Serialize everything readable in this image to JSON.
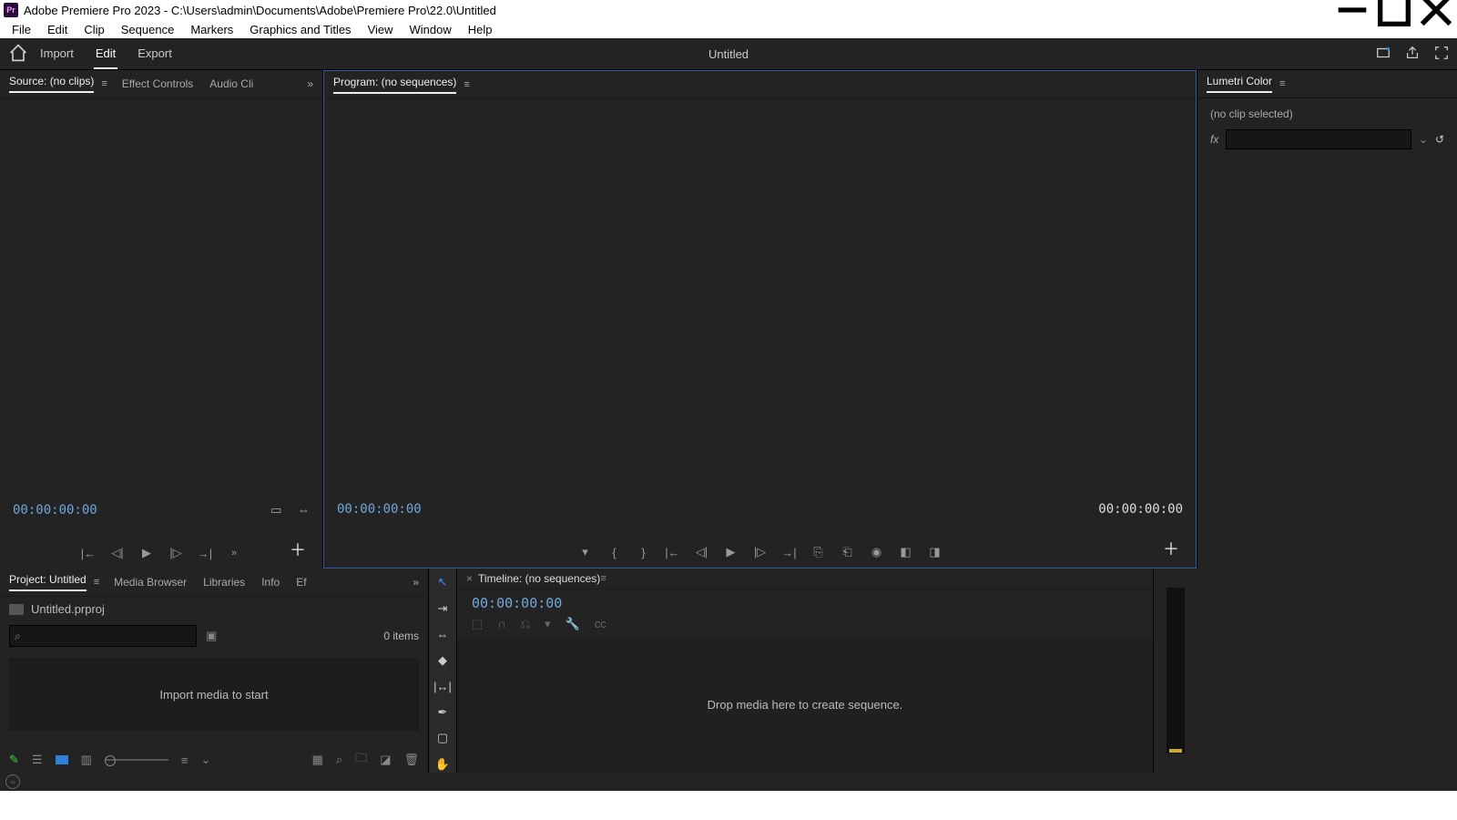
{
  "titlebar": {
    "app_short": "Pr",
    "title": "Adobe Premiere Pro 2023 - C:\\Users\\admin\\Documents\\Adobe\\Premiere Pro\\22.0\\Untitled"
  },
  "menubar": [
    "File",
    "Edit",
    "Clip",
    "Sequence",
    "Markers",
    "Graphics and Titles",
    "View",
    "Window",
    "Help"
  ],
  "workspace": {
    "tabs": [
      "Import",
      "Edit",
      "Export"
    ],
    "active": 1,
    "title": "Untitled"
  },
  "source": {
    "tabs": [
      "Source: (no clips)",
      "Effect Controls",
      "Audio Cli"
    ],
    "active": 0,
    "timecode": "00:00:00:00"
  },
  "program": {
    "title": "Program: (no sequences)",
    "timecode_left": "00:00:00:00",
    "timecode_right": "00:00:00:00"
  },
  "project": {
    "tabs": [
      "Project: Untitled",
      "Media Browser",
      "Libraries",
      "Info",
      "Ef"
    ],
    "active": 0,
    "filename": "Untitled.prproj",
    "items": "0 items",
    "drop_hint": "Import media to start"
  },
  "timeline": {
    "title": "Timeline: (no sequences)",
    "timecode": "00:00:00:00",
    "drop_hint": "Drop media here to create sequence."
  },
  "lumetri": {
    "title": "Lumetri Color",
    "status": "(no clip selected)",
    "fx": "fx"
  }
}
